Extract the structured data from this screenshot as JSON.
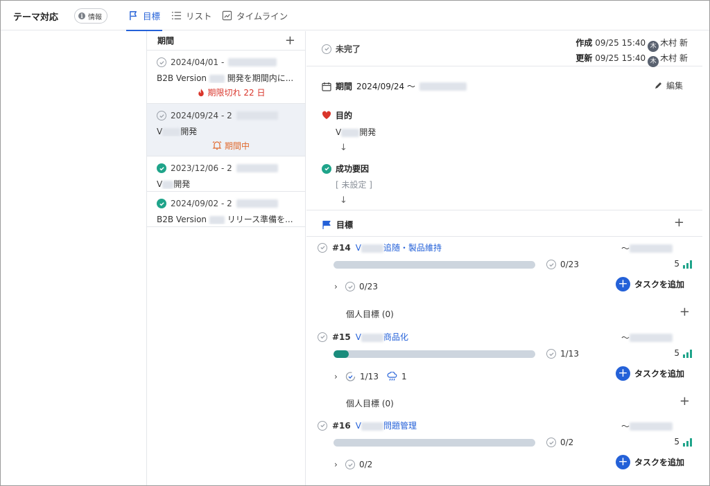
{
  "header": {
    "title": "テーマ対応",
    "info_label": "情報",
    "tabs": [
      {
        "label": "目標",
        "icon": "flag-icon",
        "active": true
      },
      {
        "label": "リスト",
        "icon": "list-icon",
        "active": false
      },
      {
        "label": "タイムライン",
        "icon": "timeline-icon",
        "active": false
      }
    ]
  },
  "periods": {
    "heading": "期間",
    "items": [
      {
        "date": "2024/04/01 -",
        "name_prefix": "B2B Version",
        "name_suffix": "開発を期間内に...",
        "status": "期限切れ 22 日",
        "status_icon": "fire-icon",
        "done": false
      },
      {
        "date": "2024/09/24 - 2",
        "name_prefix": "V",
        "name_suffix": "開発",
        "status": "期間中",
        "status_icon": "bell-icon",
        "done": false
      },
      {
        "date": "2023/12/06 - 2",
        "name_prefix": "V",
        "name_suffix": "開発",
        "status": "",
        "done": true
      },
      {
        "date": "2024/09/02 - 2",
        "name_prefix": "B2B Version",
        "name_suffix": "リリース準備を...",
        "status": "",
        "done": true
      }
    ]
  },
  "detail": {
    "status": "未完了",
    "created_label": "作成",
    "created_at": "09/25 15:40",
    "updated_label": "更新",
    "updated_at": "09/25 15:40",
    "user_initial": "木",
    "user_name": "木村 新",
    "period_label": "期間",
    "period_value": "2024/09/24 〜",
    "edit_label": "編集",
    "purpose_label": "目的",
    "purpose_prefix": "V",
    "purpose_suffix": "開発",
    "success_label": "成功要因",
    "success_value": "[ 未設定 ]",
    "goals_label": "目標"
  },
  "goals": [
    {
      "num": "#14",
      "prefix": "V",
      "suffix": "追随・製品維持",
      "due": "〜",
      "progress": 0.0,
      "count": "0/23",
      "score": "5",
      "sub_count": "0/23",
      "rain": "",
      "personal": "個人目標 (0)",
      "add": "タスクを追加"
    },
    {
      "num": "#15",
      "prefix": "V",
      "suffix": "商品化",
      "due": "〜",
      "progress": 0.077,
      "count": "1/13",
      "score": "5",
      "sub_count": "1/13",
      "rain": "1",
      "personal": "個人目標 (0)",
      "add": "タスクを追加"
    },
    {
      "num": "#16",
      "prefix": "V",
      "suffix": "問題管理",
      "due": "〜",
      "progress": 0.0,
      "count": "0/2",
      "score": "5",
      "sub_count": "0/2",
      "rain": "",
      "personal": "",
      "add": "タスクを追加"
    }
  ]
}
